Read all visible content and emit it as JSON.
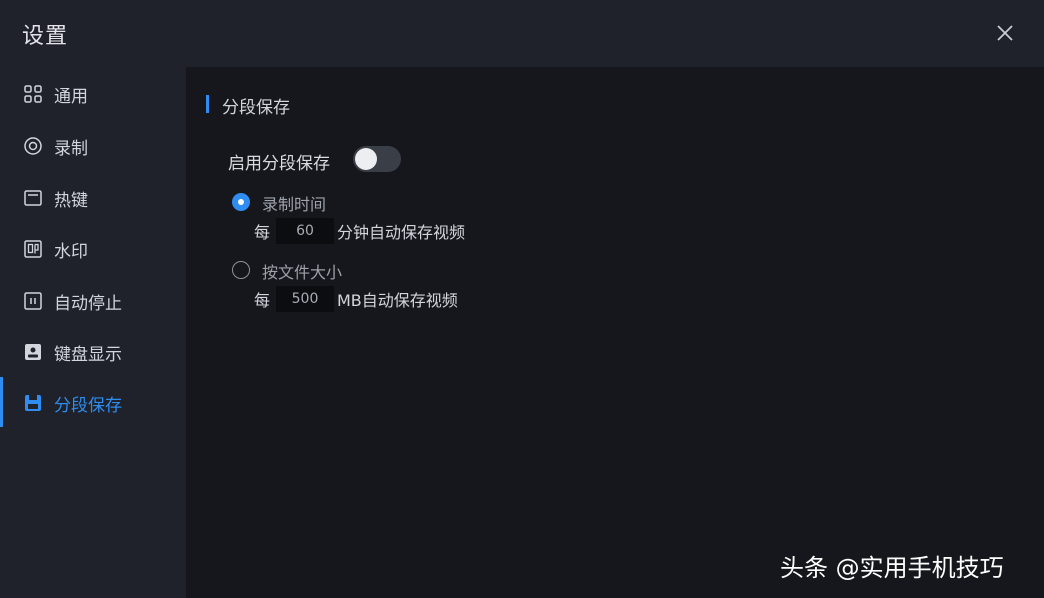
{
  "window": {
    "title": "设置"
  },
  "sidebar": {
    "items": [
      {
        "label": "通用",
        "icon": "grid-icon"
      },
      {
        "label": "录制",
        "icon": "record-icon"
      },
      {
        "label": "热键",
        "icon": "keyboard-icon"
      },
      {
        "label": "水印",
        "icon": "watermark-icon"
      },
      {
        "label": "自动停止",
        "icon": "timer-stop-icon"
      },
      {
        "label": "键盘显示",
        "icon": "keyboard-display-icon"
      },
      {
        "label": "分段保存",
        "icon": "save-icon",
        "active": true
      }
    ]
  },
  "main": {
    "section_title": "分段保存",
    "enable_label": "启用分段保存",
    "enable_toggle": false,
    "by_time": {
      "label": "录制时间",
      "checked": true,
      "prefix": "每",
      "value": "60",
      "suffix": "分钟自动保存视频"
    },
    "by_size": {
      "label": "按文件大小",
      "checked": false,
      "prefix": "每",
      "value": "500",
      "suffix": "MB自动保存视频"
    }
  },
  "watermark": {
    "text": "头条 @实用手机技巧"
  },
  "colors": {
    "accent": "#2f8cf0",
    "sidebar_bg": "#1f222a",
    "content_bg": "#15171c"
  }
}
